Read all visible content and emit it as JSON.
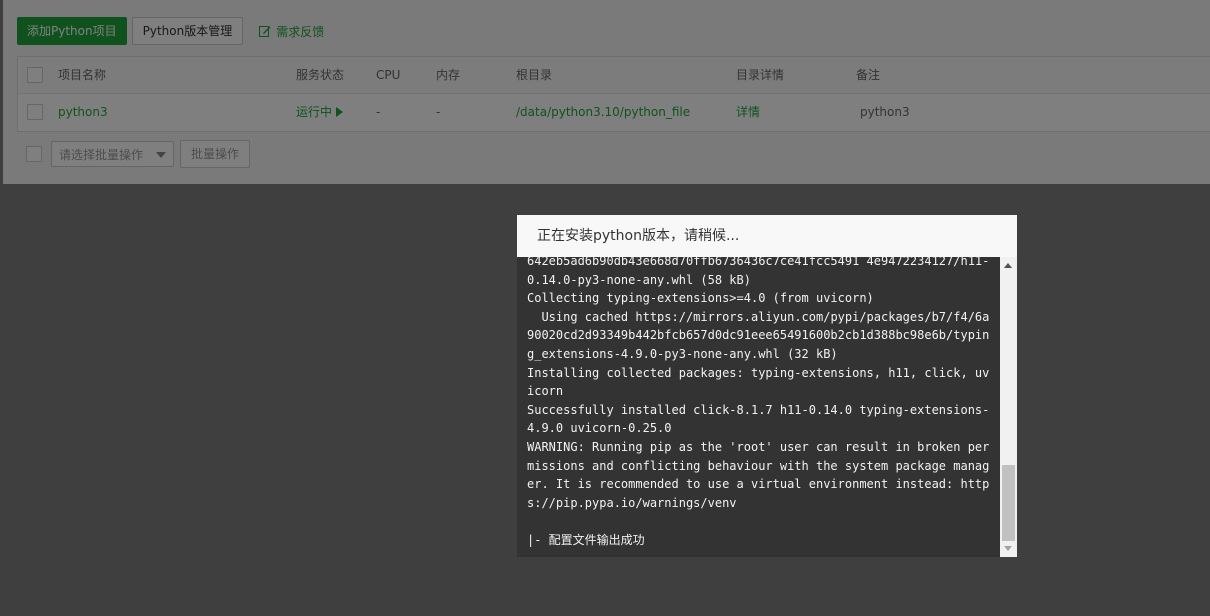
{
  "toolbar": {
    "add_project": "添加Python项目",
    "version_manage": "Python版本管理",
    "feedback": "需求反馈"
  },
  "table": {
    "headers": {
      "name": "项目名称",
      "status": "服务状态",
      "cpu": "CPU",
      "mem": "内存",
      "root": "根目录",
      "dir_detail": "目录详情",
      "remark": "备注"
    },
    "rows": [
      {
        "name": "python3",
        "status": "运行中",
        "cpu": "-",
        "mem": "-",
        "root": "/data/python3.10/python_file",
        "dir_detail": "详情",
        "remark": "python3"
      }
    ]
  },
  "batch": {
    "select_placeholder": "请选择批量操作",
    "button": "批量操作"
  },
  "modal": {
    "title": "正在安装python版本，请稍候...",
    "log": "642eb5ad6b90db43e668d70ffb6736436c7ce41fcc5491 4e9472234127/h11-0.14.0-py3-none-any.whl (58 kB)\nCollecting typing-extensions>=4.0 (from uvicorn)\n  Using cached https://mirrors.aliyun.com/pypi/packages/b7/f4/6a90020cd2d93349b442bfcb657d0dc91eee65491600b2cb1d388bc98e6b/typing_extensions-4.9.0-py3-none-any.whl (32 kB)\nInstalling collected packages: typing-extensions, h11, click, uvicorn\nSuccessfully installed click-8.1.7 h11-0.14.0 typing-extensions-4.9.0 uvicorn-0.25.0\nWARNING: Running pip as the 'root' user can result in broken permissions and conflicting behaviour with the system package manager. It is recommended to use a virtual environment instead: https://pip.pypa.io/warnings/venv\n\n|- 配置文件输出成功"
  },
  "colors": {
    "accent": "#20a53a",
    "console_bg": "#333333",
    "console_text": "#f2f2f2"
  }
}
